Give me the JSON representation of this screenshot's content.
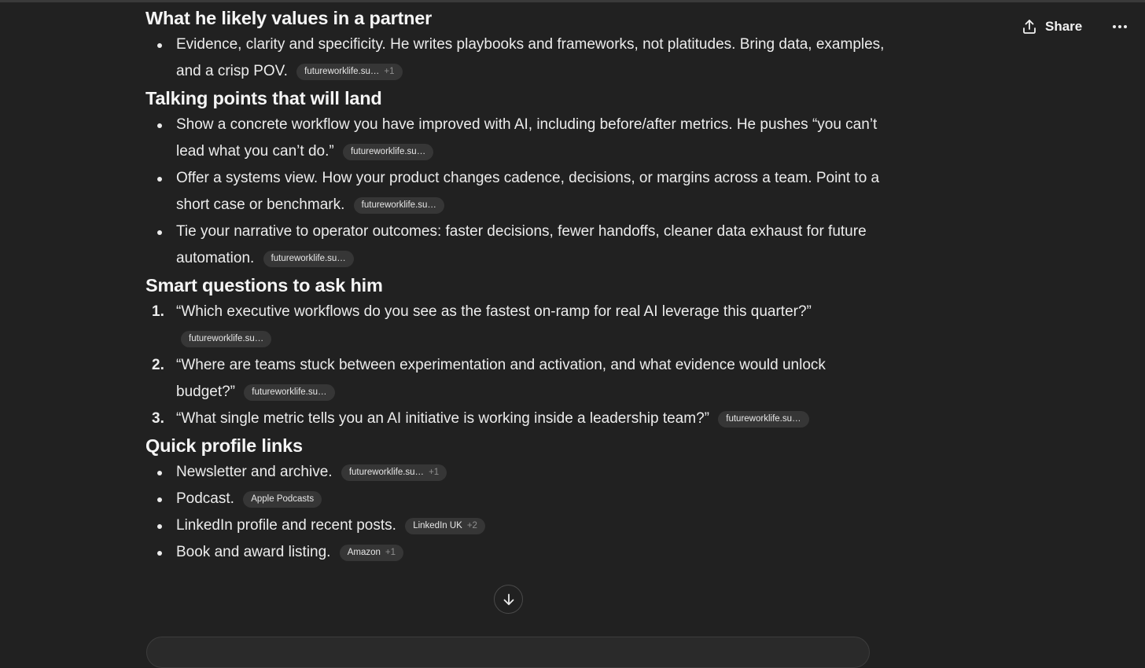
{
  "header": {
    "share_label": "Share",
    "share_icon": "share-upload-icon",
    "more_icon": "ellipsis-icon"
  },
  "sections": [
    {
      "heading": "What he likely values in a partner",
      "items": [
        {
          "text": "Evidence, clarity and specificity. He writes playbooks and frameworks, not platitudes. Bring data, examples, and a crisp POV.",
          "source": "futureworklife.su…",
          "extra": "+1"
        }
      ]
    },
    {
      "heading": "Talking points that will land",
      "items": [
        {
          "text": "Show a concrete workflow you have improved with AI, including before/after metrics. He pushes “you can’t lead what you can’t do.”",
          "source": "futureworklife.su…"
        },
        {
          "text": "Offer a systems view. How your product changes cadence, decisions, or margins across a team. Point to a short case or benchmark.",
          "source": "futureworklife.su…"
        },
        {
          "text": "Tie your narrative to operator outcomes: faster decisions, fewer handoffs, cleaner data exhaust for future automation.",
          "source": "futureworklife.su…"
        }
      ]
    },
    {
      "heading": "Smart questions to ask him",
      "items": [
        {
          "number": "1.",
          "text": "“Which executive workflows do you see as the fastest on-ramp for real AI leverage this quarter?”",
          "source": "futureworklife.su…"
        },
        {
          "number": "2.",
          "text": "“Where are teams stuck between experimentation and activation, and what evidence would unlock budget?”",
          "source": "futureworklife.su…"
        },
        {
          "number": "3.",
          "text": "“What single metric tells you an AI initiative is working inside a leadership team?”",
          "source": "futureworklife.su…"
        }
      ]
    },
    {
      "heading": "Quick profile links",
      "items": [
        {
          "text": "Newsletter and archive.",
          "source": "futureworklife.su…",
          "extra": "+1"
        },
        {
          "text": "Podcast.",
          "source": "Apple Podcasts"
        },
        {
          "text": "LinkedIn profile and recent posts.",
          "source": "LinkedIn UK",
          "extra": "+2"
        },
        {
          "text": "Book and award listing.",
          "source": "Amazon",
          "extra": "+1"
        }
      ]
    }
  ],
  "scroll_icon": "arrow-down-icon"
}
